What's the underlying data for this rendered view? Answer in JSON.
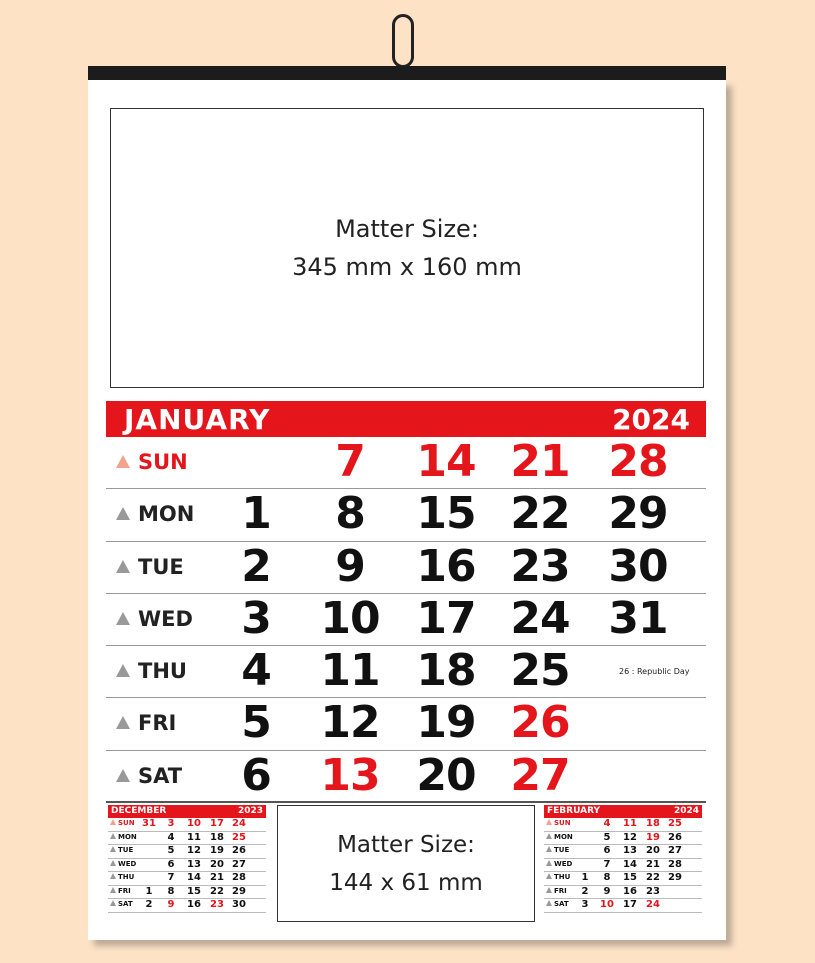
{
  "matter_big": {
    "line1": "Matter Size:",
    "line2": "345 mm x 160 mm"
  },
  "month": {
    "name": "JANUARY",
    "year": "2024"
  },
  "days": [
    {
      "label": "SUN",
      "red": true,
      "dates": [
        "",
        "7",
        "14",
        "21",
        "28"
      ],
      "red_dates": [
        1,
        2,
        3,
        4
      ]
    },
    {
      "label": "MON",
      "red": false,
      "dates": [
        "1",
        "8",
        "15",
        "22",
        "29"
      ],
      "red_dates": []
    },
    {
      "label": "TUE",
      "red": false,
      "dates": [
        "2",
        "9",
        "16",
        "23",
        "30"
      ],
      "red_dates": []
    },
    {
      "label": "WED",
      "red": false,
      "dates": [
        "3",
        "10",
        "17",
        "24",
        "31"
      ],
      "red_dates": []
    },
    {
      "label": "THU",
      "red": false,
      "dates": [
        "4",
        "11",
        "18",
        "25",
        ""
      ],
      "red_dates": []
    },
    {
      "label": "FRI",
      "red": false,
      "dates": [
        "5",
        "12",
        "19",
        "26",
        ""
      ],
      "red_dates": [
        3
      ]
    },
    {
      "label": "SAT",
      "red": false,
      "dates": [
        "6",
        "13",
        "20",
        "27",
        ""
      ],
      "red_dates": [
        1,
        3
      ]
    }
  ],
  "holiday_note": "26 : Republic Day",
  "matter_small": {
    "line1": "Matter Size:",
    "line2": "144 x 61 mm"
  },
  "prev_month": {
    "name": "DECEMBER",
    "year": "2023",
    "rows": [
      {
        "label": "SUN",
        "red": true,
        "dates": [
          "31",
          "3",
          "10",
          "17",
          "24"
        ]
      },
      {
        "label": "MON",
        "red": false,
        "dates": [
          "",
          "4",
          "11",
          "18",
          "25"
        ],
        "red_idx": [
          4
        ]
      },
      {
        "label": "TUE",
        "red": false,
        "dates": [
          "",
          "5",
          "12",
          "19",
          "26"
        ]
      },
      {
        "label": "WED",
        "red": false,
        "dates": [
          "",
          "6",
          "13",
          "20",
          "27"
        ]
      },
      {
        "label": "THU",
        "red": false,
        "dates": [
          "",
          "7",
          "14",
          "21",
          "28"
        ]
      },
      {
        "label": "FRI",
        "red": false,
        "dates": [
          "1",
          "8",
          "15",
          "22",
          "29"
        ]
      },
      {
        "label": "SAT",
        "red": false,
        "dates": [
          "2",
          "9",
          "16",
          "23",
          "30"
        ],
        "red_idx": [
          1,
          3
        ]
      }
    ]
  },
  "next_month": {
    "name": "FEBRUARY",
    "year": "2024",
    "rows": [
      {
        "label": "SUN",
        "red": true,
        "dates": [
          "",
          "4",
          "11",
          "18",
          "25"
        ]
      },
      {
        "label": "MON",
        "red": false,
        "dates": [
          "",
          "5",
          "12",
          "19",
          "26"
        ],
        "red_idx": [
          3
        ]
      },
      {
        "label": "TUE",
        "red": false,
        "dates": [
          "",
          "6",
          "13",
          "20",
          "27"
        ]
      },
      {
        "label": "WED",
        "red": false,
        "dates": [
          "",
          "7",
          "14",
          "21",
          "28"
        ]
      },
      {
        "label": "THU",
        "red": false,
        "dates": [
          "1",
          "8",
          "15",
          "22",
          "29"
        ]
      },
      {
        "label": "FRI",
        "red": false,
        "dates": [
          "2",
          "9",
          "16",
          "23",
          ""
        ]
      },
      {
        "label": "SAT",
        "red": false,
        "dates": [
          "3",
          "10",
          "17",
          "24",
          ""
        ],
        "red_idx": [
          1,
          3
        ]
      }
    ]
  },
  "colors": {
    "accent": "#e4151b",
    "background": "#fde2c6"
  }
}
